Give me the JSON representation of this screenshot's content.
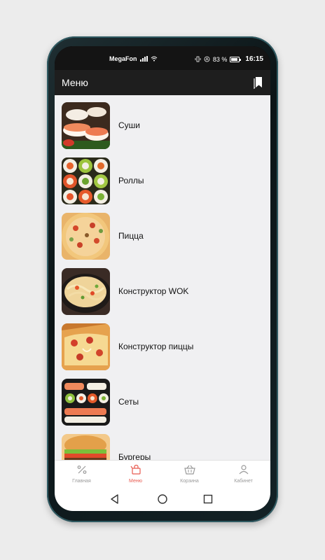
{
  "status_bar": {
    "carrier": "MegaFon",
    "battery": "83 %",
    "battery_level": 0.83,
    "time": "16:15"
  },
  "app_bar": {
    "title": "Меню",
    "bookmark_icon": "bookmark-icon"
  },
  "menu": {
    "items": [
      {
        "label": "Суши",
        "image": "sushi-image"
      },
      {
        "label": "Роллы",
        "image": "rolls-image"
      },
      {
        "label": "Пицца",
        "image": "pizza-image"
      },
      {
        "label": "Конструктор WOK",
        "image": "wok-image"
      },
      {
        "label": "Конструктор пиццы",
        "image": "pizza-builder-image"
      },
      {
        "label": "Сеты",
        "image": "sets-image"
      },
      {
        "label": "Бургеры",
        "image": "burgers-image"
      }
    ]
  },
  "bottom_nav": {
    "tabs": [
      {
        "label": "Главная",
        "icon": "percent-icon",
        "active": false
      },
      {
        "label": "Меню",
        "icon": "menu-bag-icon",
        "active": true
      },
      {
        "label": "Корзина",
        "icon": "basket-icon",
        "active": false
      },
      {
        "label": "Кабинет",
        "icon": "user-icon",
        "active": false
      }
    ],
    "active_color": "#e85a4f",
    "inactive_color": "#9a9a9a"
  },
  "system_nav": {
    "buttons": [
      "back-icon",
      "home-icon",
      "recents-icon"
    ]
  }
}
